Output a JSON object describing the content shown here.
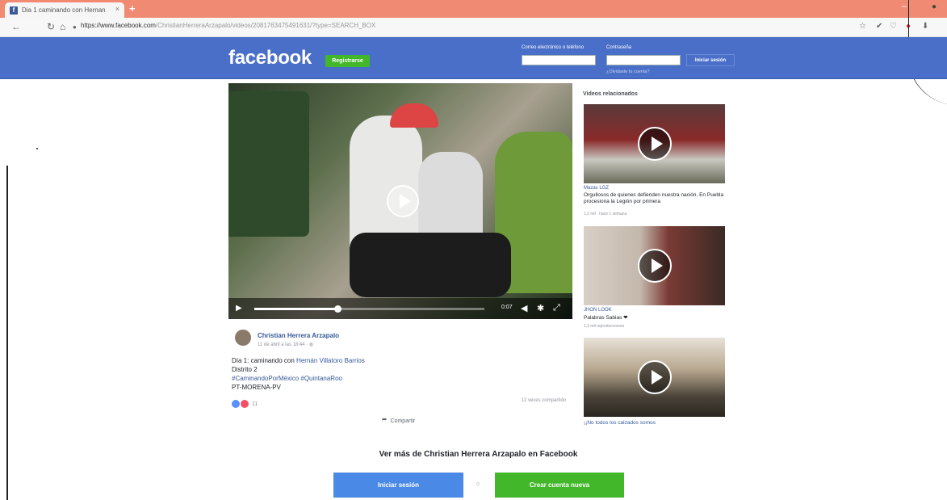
{
  "browser": {
    "tab_title": "Dia 1 caminando con Hernan",
    "tab_favicon": "f",
    "tab_close": "×",
    "new_tab": "+",
    "url_host": "https://www.facebook.com",
    "url_path": "/ChristianHerreraArzapalo/videos/2081763475491631/?type=SEARCH_BOX",
    "minimize": "–"
  },
  "header": {
    "logo": "facebook",
    "signup_label": "Registrarse",
    "email_label": "Correo electrónico o teléfono",
    "password_label": "Contraseña",
    "login_label": "Iniciar sesión",
    "forgot_label": "¿Olvidaste tu cuenta?"
  },
  "video": {
    "time": "0:07",
    "progress_fraction": 0.36
  },
  "post": {
    "author": "Christian Herrera Arzapalo",
    "date": "11 de abril a las 18:44 · ◍",
    "line1_prefix": "Día 1: caminando con ",
    "line1_link": "Hernán Villatoro Barrios",
    "line2": "Distrito 2",
    "line3": "#CaminandoPorMéxico #QuintanaRoo",
    "line4": "PT-MORENA-PV",
    "reaction_count": "11",
    "shares": "12 veces compartido",
    "share_label": "Compartir"
  },
  "related": {
    "title": "Videos relacionados",
    "items": [
      {
        "source": "Mazas LGZ",
        "text": "Orgullosos de quienes defienden nuestra nación. En Puebla procesiona la Legión por primera",
        "meta": "1,2 mil · hace 1 semana"
      },
      {
        "source": "JHON LOOK",
        "text": "Palabras Sabias ❤",
        "meta": "1,3 mil reproducciones"
      },
      {
        "source": "",
        "text": "¡¡No todos los calzados somos",
        "meta": ""
      }
    ]
  },
  "footer": {
    "see_more": "Ver más de Christian Herrera Arzapalo en Facebook",
    "login": "Iniciar sesión",
    "or": "o",
    "create": "Crear cuenta nueva"
  },
  "colors": {
    "facebook_blue": "#4a6fc8",
    "green": "#42b72a",
    "tab_bar": "#f08a72"
  }
}
